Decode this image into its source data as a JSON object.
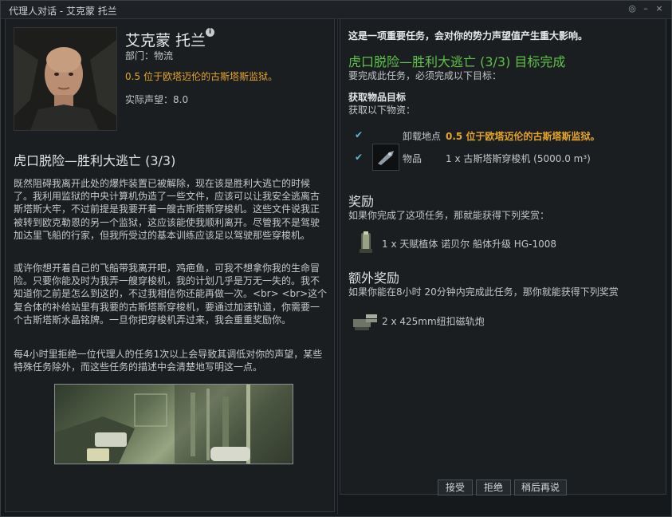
{
  "window": {
    "title": "代理人对话 - 艾克蒙 托兰",
    "controls": [
      "◎",
      "–",
      "×"
    ]
  },
  "agent": {
    "name": "艾克蒙 托兰",
    "department": "部门：物流",
    "location_security": "0.5",
    "location": "位于欧塔迈伦的古斯塔斯监狱。",
    "standing": "实际声望：8.0"
  },
  "mission": {
    "title": "虎口脱险—胜利大逃亡 (3/3)",
    "paragraph1": "既然阻碍我离开此处的爆炸装置已被解除，现在该是胜利大逃亡的时候了。我利用监狱的中央计算机伪造了一些文件，应该可以让我安全逃离古斯塔斯大牢，不过前提是我要开着一艘古斯塔斯穿梭机。这些文件说我正被转到欧克勒恩的另一个监狱，这应该能使我顺利离开。尽管我不是驾驶加达里飞船的行家，但我所受过的基本训练应该足以驾驶那些穿梭机。",
    "paragraph2": "或许你想开着自己的飞船带我离开吧，鸡疤鱼，可我不想拿你我的生命冒险。只要你能及时为我弄一艘穿梭机，我的计划几乎是万无一失的。我不知道你之前是怎么到这的，不过我相信你还能再做一次。<br> <br>这个复合体的补给站里有我要的古斯塔斯穿梭机，要通过加速轨道，你需要一个古斯塔斯水晶铭牌。一旦你把穿梭机弄过来，我会重重奖励你。",
    "paragraph3": "每4小时里拒绝一位代理人的任务1次以上会导致其调低对你的声望，某些特殊任务除外，而这些任务的描述中会清楚地写明这一点。"
  },
  "objectives": {
    "importance": "这是一项重要任务，会对你的势力声望值产生重大影响。",
    "status_title": "虎口脱险—胜利大逃亡 (3/3) 目标完成",
    "requirement": "要完成此任务，必须完成以下目标：",
    "fetch_header": "获取物品目标",
    "fetch_sub": "获取以下物资：",
    "dropoff_label": "卸载地点",
    "dropoff_security": "0.5",
    "dropoff_location": "位于欧塔迈伦的古斯塔斯监狱。",
    "item_label": "物品",
    "item_value": "1 x 古斯塔斯穿梭机 (5000.0 m³)"
  },
  "rewards": {
    "header": "奖励",
    "desc": "如果你完成了这项任务，那就能获得下列奖赏：",
    "item": "1 x 天赋植体 诺贝尔 船体升级 HG-1008",
    "bonus_header": "额外奖励",
    "bonus_desc": "如果你能在8小时 20分钟内完成此任务，那你就能获得下列奖赏",
    "bonus_item": "2 x 425mm纽扣磁轨炮"
  },
  "buttons": {
    "accept": "接受",
    "decline": "拒绝",
    "later": "稍后再说"
  },
  "colors": {
    "security": "#e5a52a",
    "complete": "#5fc24a",
    "check": "#5fb7e0"
  },
  "icons": {
    "check": "checkmark-icon",
    "shuttle": "shuttle-icon",
    "implant": "implant-icon",
    "railgun": "railgun-icon"
  }
}
